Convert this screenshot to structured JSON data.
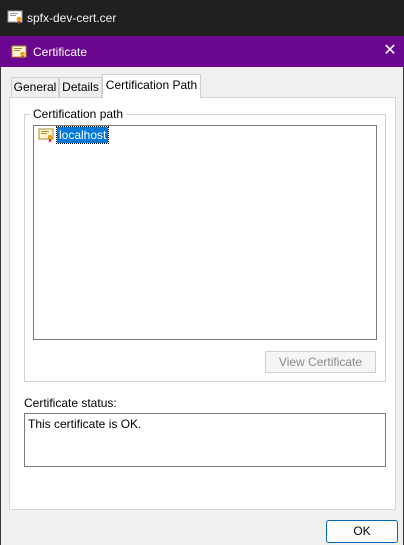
{
  "outer_window": {
    "title": "spfx-dev-cert.cer"
  },
  "dialog": {
    "title": "Certificate",
    "close_glyph": "✕"
  },
  "tabs": [
    {
      "label": "General",
      "active": false
    },
    {
      "label": "Details",
      "active": false
    },
    {
      "label": "Certification Path",
      "active": true
    }
  ],
  "certification_path": {
    "group_label": "Certification path",
    "items": [
      {
        "label": "localhost",
        "icon": "certificate-icon",
        "selected": true
      }
    ],
    "view_button": "View Certificate"
  },
  "status": {
    "label": "Certificate status:",
    "value": "This certificate is OK."
  },
  "buttons": {
    "ok": "OK"
  },
  "colors": {
    "titlebar": "#6a078e",
    "selection": "#0078d7",
    "outer_bar": "#202020"
  }
}
